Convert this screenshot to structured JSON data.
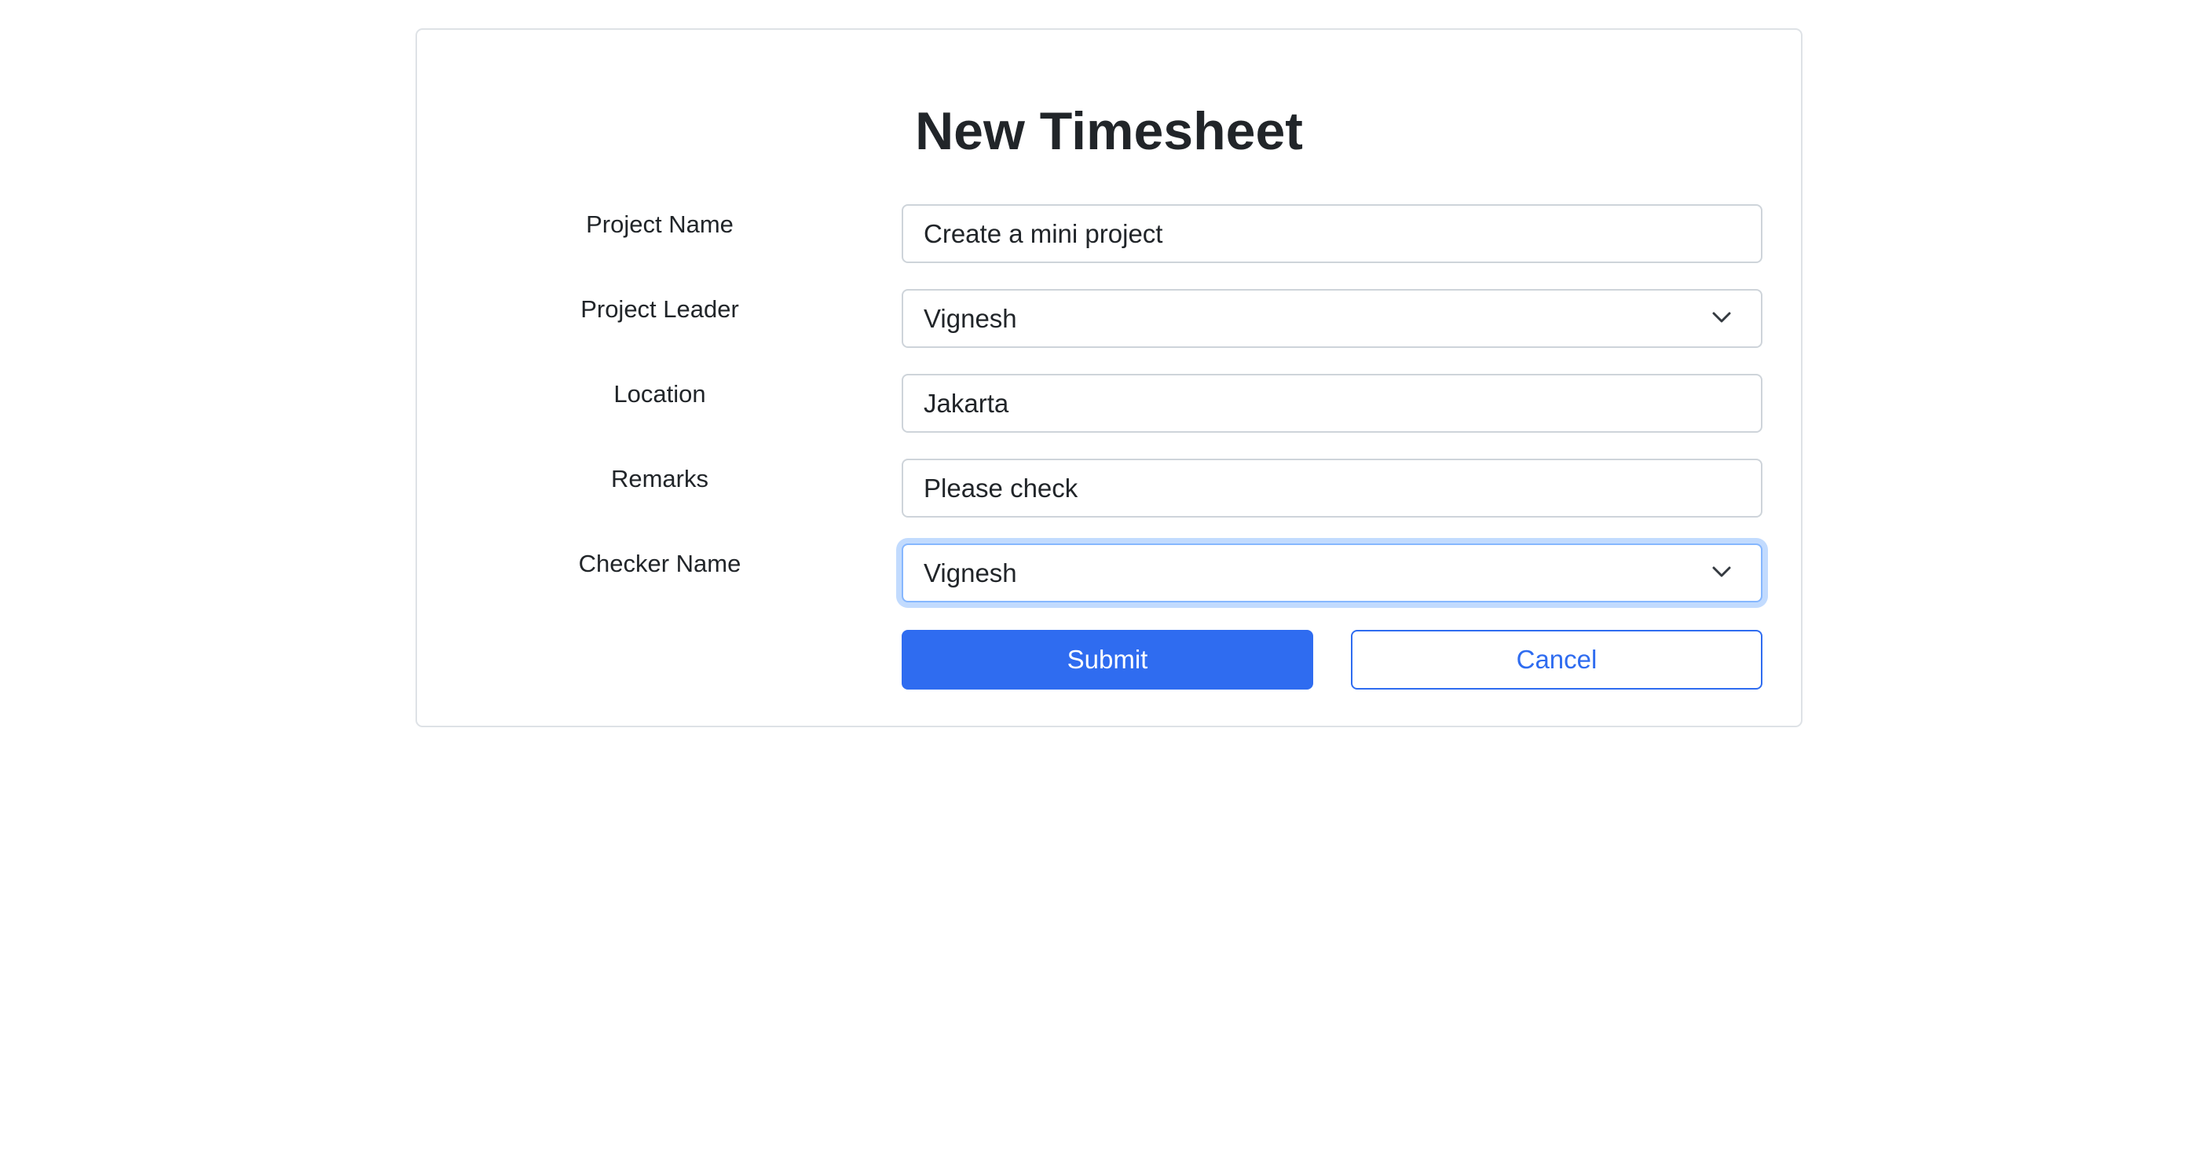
{
  "form": {
    "title": "New Timesheet",
    "fields": [
      {
        "label": "Project Name",
        "value": "Create a mini project",
        "type": "text"
      },
      {
        "label": "Project Leader",
        "value": "Vignesh",
        "type": "select"
      },
      {
        "label": "Location",
        "value": "Jakarta",
        "type": "text"
      },
      {
        "label": "Remarks",
        "value": "Please check",
        "type": "text"
      },
      {
        "label": "Checker Name",
        "value": "Vignesh",
        "type": "select",
        "focused": true
      }
    ],
    "submit_label": "Submit",
    "cancel_label": "Cancel"
  },
  "icons": {
    "select_indicator": "chevron-down-icon"
  },
  "colors": {
    "primary": "#2f6cf0",
    "focus_ring": "#86b7fe",
    "border": "#ced4da",
    "text": "#212529"
  }
}
